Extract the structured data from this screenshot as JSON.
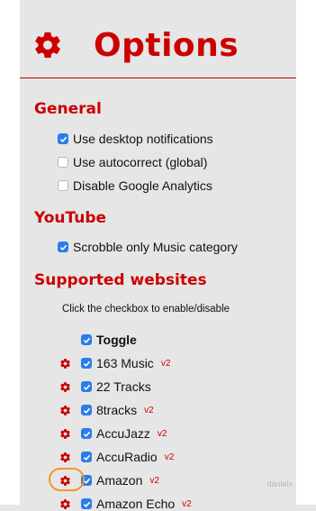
{
  "header": {
    "title": "Options",
    "icon": "gear-icon",
    "accent_color": "#cc0000"
  },
  "general": {
    "title": "General",
    "options": [
      {
        "label": "Use desktop notifications",
        "checked": true
      },
      {
        "label": "Use autocorrect (global)",
        "checked": false
      },
      {
        "label": "Disable Google Analytics",
        "checked": false
      }
    ]
  },
  "youtube": {
    "title": "YouTube",
    "options": [
      {
        "label": "Scrobble only Music category",
        "checked": true
      }
    ]
  },
  "supported": {
    "title": "Supported websites",
    "hint": "Click the checkbox to enable/disable",
    "toggle_label": "Toggle",
    "sites": [
      {
        "name": "163 Music",
        "badge": "v2",
        "checked": true
      },
      {
        "name": "22 Tracks",
        "badge": "",
        "checked": true
      },
      {
        "name": "8tracks",
        "badge": "v2",
        "checked": true
      },
      {
        "name": "AccuJazz",
        "badge": "v2",
        "checked": true
      },
      {
        "name": "AccuRadio",
        "badge": "v2",
        "checked": true
      },
      {
        "name": "Amazon",
        "badge": "v2",
        "checked": true
      },
      {
        "name": "Amazon Echo",
        "badge": "v2",
        "checked": true
      }
    ]
  },
  "watermark": "danielx",
  "colors": {
    "checkbox_on": "#2b7de9",
    "highlight": "#f0962b"
  }
}
